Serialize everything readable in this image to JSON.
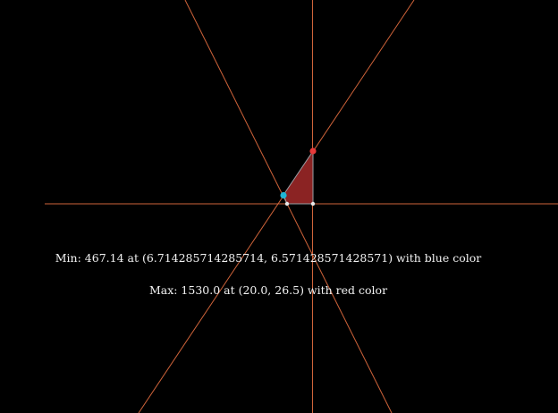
{
  "colors": {
    "background": "#000000",
    "constraint_line": "#d0643a",
    "feasible_region_fill": "#8b2323",
    "feasible_region_edge": "#9aa0a6",
    "min_point": "#1fb6d6",
    "max_point": "#e83a3a",
    "vertex": "#e8e8e8",
    "text": "#f2f2f2"
  },
  "result": {
    "min_text": "Min: 467.14 at (6.714285714285714, 6.571428571428571) with blue color",
    "max_text": "Max: 1530.0 at (20.0, 26.5) with red color"
  },
  "optimization": {
    "min_value": 467.14,
    "min_point": [
      6.714285714285714,
      6.571428571428571
    ],
    "min_color": "blue",
    "max_value": 1530.0,
    "max_point": [
      20.0,
      26.5
    ],
    "max_color": "red"
  }
}
